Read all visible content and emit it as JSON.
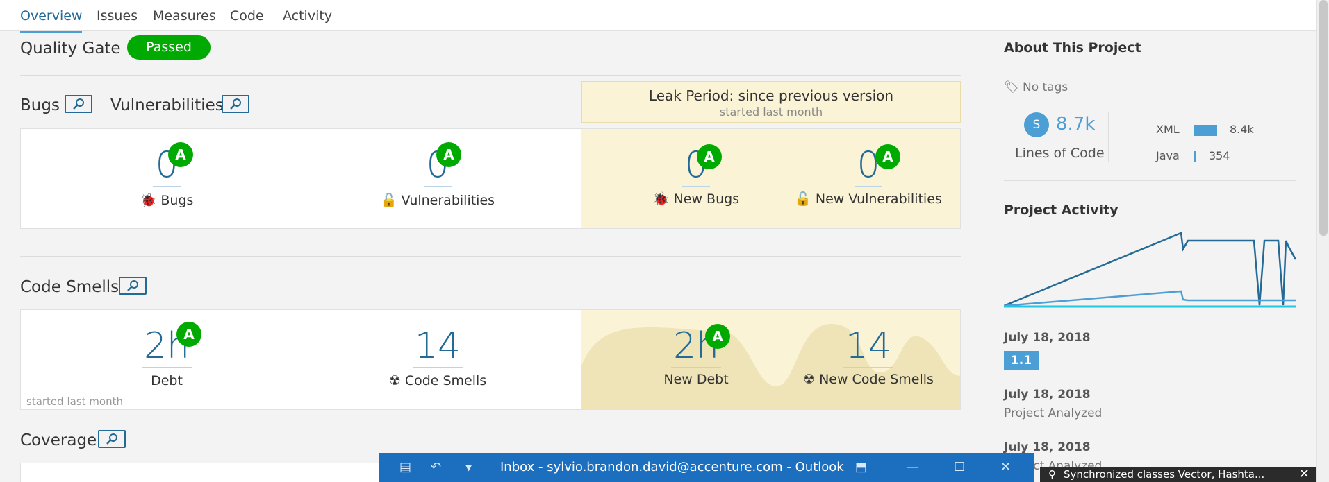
{
  "nav": {
    "tabs": [
      "Overview",
      "Issues",
      "Measures",
      "Code",
      "Activity"
    ],
    "active": "Overview"
  },
  "quality_gate": {
    "label": "Quality Gate",
    "status": "Passed"
  },
  "reliability": {
    "bugs_title": "Bugs",
    "vuln_title": "Vulnerabilities",
    "leak_period": {
      "title": "Leak Period: since previous version",
      "subtitle": "started last month"
    },
    "bugs": {
      "value": "0",
      "rating": "A",
      "label": "Bugs"
    },
    "vulnerabilities": {
      "value": "0",
      "rating": "A",
      "label": "Vulnerabilities"
    },
    "new_bugs": {
      "value": "0",
      "rating": "A",
      "label": "New Bugs"
    },
    "new_vulnerabilities": {
      "value": "0",
      "rating": "A",
      "label": "New Vulnerabilities"
    }
  },
  "maintainability": {
    "title": "Code Smells",
    "debt": {
      "value": "2h",
      "rating": "A",
      "label": "Debt"
    },
    "code_smells": {
      "value": "14",
      "label": "Code Smells"
    },
    "new_debt": {
      "value": "2h",
      "rating": "A",
      "label": "New Debt"
    },
    "new_code_smells": {
      "value": "14",
      "label": "New Code Smells"
    },
    "started": "started last month"
  },
  "coverage": {
    "title": "Coverage"
  },
  "sidebar": {
    "about_title": "About This Project",
    "tags": "No tags",
    "loc": {
      "initial": "S",
      "value": "8.7k",
      "label": "Lines of Code"
    },
    "languages": [
      {
        "name": "XML",
        "value": "8.4k",
        "fraction": 0.96
      },
      {
        "name": "Java",
        "value": "354",
        "fraction": 0.04
      }
    ],
    "activity_title": "Project Activity",
    "events": [
      {
        "date": "July 18, 2018",
        "version": "1.1"
      },
      {
        "date": "July 18, 2018",
        "text": "Project Analyzed"
      },
      {
        "date": "July 18, 2018",
        "text": "Project Analyzed"
      }
    ]
  },
  "taskbar": {
    "window_title": "Inbox - sylvio.brandon.david@accenture.com  -  Outlook"
  },
  "toast": {
    "text": "Synchronized classes Vector, Hashta..."
  },
  "colors": {
    "accent": "#236a97",
    "pass": "#00aa00",
    "leak": "#fbf3d5",
    "taskbar": "#1c6fbf"
  }
}
